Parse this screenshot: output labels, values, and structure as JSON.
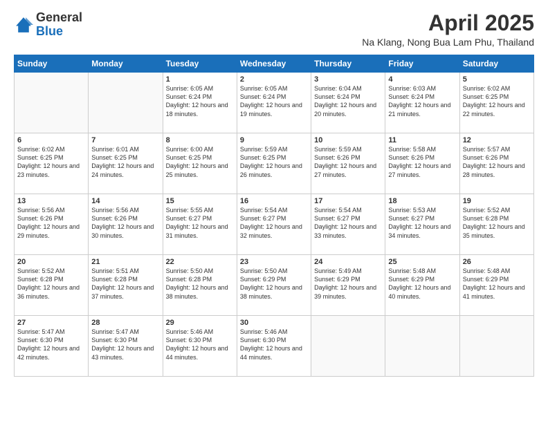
{
  "logo": {
    "general": "General",
    "blue": "Blue"
  },
  "header": {
    "month": "April 2025",
    "location": "Na Klang, Nong Bua Lam Phu, Thailand"
  },
  "days_of_week": [
    "Sunday",
    "Monday",
    "Tuesday",
    "Wednesday",
    "Thursday",
    "Friday",
    "Saturday"
  ],
  "weeks": [
    [
      {
        "day": "",
        "info": ""
      },
      {
        "day": "",
        "info": ""
      },
      {
        "day": "1",
        "info": "Sunrise: 6:05 AM\nSunset: 6:24 PM\nDaylight: 12 hours and 18 minutes."
      },
      {
        "day": "2",
        "info": "Sunrise: 6:05 AM\nSunset: 6:24 PM\nDaylight: 12 hours and 19 minutes."
      },
      {
        "day": "3",
        "info": "Sunrise: 6:04 AM\nSunset: 6:24 PM\nDaylight: 12 hours and 20 minutes."
      },
      {
        "day": "4",
        "info": "Sunrise: 6:03 AM\nSunset: 6:24 PM\nDaylight: 12 hours and 21 minutes."
      },
      {
        "day": "5",
        "info": "Sunrise: 6:02 AM\nSunset: 6:25 PM\nDaylight: 12 hours and 22 minutes."
      }
    ],
    [
      {
        "day": "6",
        "info": "Sunrise: 6:02 AM\nSunset: 6:25 PM\nDaylight: 12 hours and 23 minutes."
      },
      {
        "day": "7",
        "info": "Sunrise: 6:01 AM\nSunset: 6:25 PM\nDaylight: 12 hours and 24 minutes."
      },
      {
        "day": "8",
        "info": "Sunrise: 6:00 AM\nSunset: 6:25 PM\nDaylight: 12 hours and 25 minutes."
      },
      {
        "day": "9",
        "info": "Sunrise: 5:59 AM\nSunset: 6:25 PM\nDaylight: 12 hours and 26 minutes."
      },
      {
        "day": "10",
        "info": "Sunrise: 5:59 AM\nSunset: 6:26 PM\nDaylight: 12 hours and 27 minutes."
      },
      {
        "day": "11",
        "info": "Sunrise: 5:58 AM\nSunset: 6:26 PM\nDaylight: 12 hours and 27 minutes."
      },
      {
        "day": "12",
        "info": "Sunrise: 5:57 AM\nSunset: 6:26 PM\nDaylight: 12 hours and 28 minutes."
      }
    ],
    [
      {
        "day": "13",
        "info": "Sunrise: 5:56 AM\nSunset: 6:26 PM\nDaylight: 12 hours and 29 minutes."
      },
      {
        "day": "14",
        "info": "Sunrise: 5:56 AM\nSunset: 6:26 PM\nDaylight: 12 hours and 30 minutes."
      },
      {
        "day": "15",
        "info": "Sunrise: 5:55 AM\nSunset: 6:27 PM\nDaylight: 12 hours and 31 minutes."
      },
      {
        "day": "16",
        "info": "Sunrise: 5:54 AM\nSunset: 6:27 PM\nDaylight: 12 hours and 32 minutes."
      },
      {
        "day": "17",
        "info": "Sunrise: 5:54 AM\nSunset: 6:27 PM\nDaylight: 12 hours and 33 minutes."
      },
      {
        "day": "18",
        "info": "Sunrise: 5:53 AM\nSunset: 6:27 PM\nDaylight: 12 hours and 34 minutes."
      },
      {
        "day": "19",
        "info": "Sunrise: 5:52 AM\nSunset: 6:28 PM\nDaylight: 12 hours and 35 minutes."
      }
    ],
    [
      {
        "day": "20",
        "info": "Sunrise: 5:52 AM\nSunset: 6:28 PM\nDaylight: 12 hours and 36 minutes."
      },
      {
        "day": "21",
        "info": "Sunrise: 5:51 AM\nSunset: 6:28 PM\nDaylight: 12 hours and 37 minutes."
      },
      {
        "day": "22",
        "info": "Sunrise: 5:50 AM\nSunset: 6:28 PM\nDaylight: 12 hours and 38 minutes."
      },
      {
        "day": "23",
        "info": "Sunrise: 5:50 AM\nSunset: 6:29 PM\nDaylight: 12 hours and 38 minutes."
      },
      {
        "day": "24",
        "info": "Sunrise: 5:49 AM\nSunset: 6:29 PM\nDaylight: 12 hours and 39 minutes."
      },
      {
        "day": "25",
        "info": "Sunrise: 5:48 AM\nSunset: 6:29 PM\nDaylight: 12 hours and 40 minutes."
      },
      {
        "day": "26",
        "info": "Sunrise: 5:48 AM\nSunset: 6:29 PM\nDaylight: 12 hours and 41 minutes."
      }
    ],
    [
      {
        "day": "27",
        "info": "Sunrise: 5:47 AM\nSunset: 6:30 PM\nDaylight: 12 hours and 42 minutes."
      },
      {
        "day": "28",
        "info": "Sunrise: 5:47 AM\nSunset: 6:30 PM\nDaylight: 12 hours and 43 minutes."
      },
      {
        "day": "29",
        "info": "Sunrise: 5:46 AM\nSunset: 6:30 PM\nDaylight: 12 hours and 44 minutes."
      },
      {
        "day": "30",
        "info": "Sunrise: 5:46 AM\nSunset: 6:30 PM\nDaylight: 12 hours and 44 minutes."
      },
      {
        "day": "",
        "info": ""
      },
      {
        "day": "",
        "info": ""
      },
      {
        "day": "",
        "info": ""
      }
    ]
  ]
}
